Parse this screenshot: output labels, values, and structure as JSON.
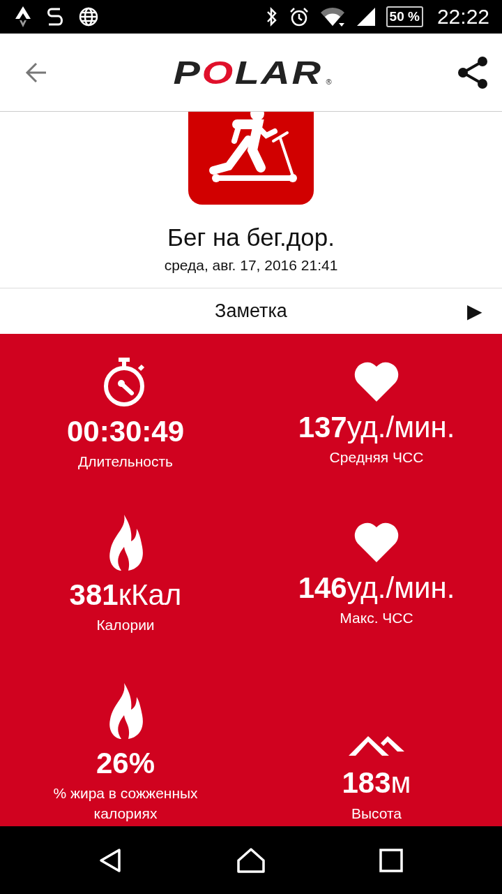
{
  "status_bar": {
    "battery": "50 %",
    "time": "22:22"
  },
  "header": {
    "logo": "POLAR",
    "registered_mark": "®"
  },
  "activity": {
    "title": "Бег на бег.дор.",
    "date": "среда, авг. 17, 2016 21:41"
  },
  "note": {
    "label": "Заметка",
    "arrow": "▶"
  },
  "stats": [
    {
      "kind": "stopwatch",
      "value": "**00:30:49**",
      "label": "Длительность"
    },
    {
      "kind": "heart",
      "value": "**137**уд./мин.",
      "label": "Средняя ЧСС"
    },
    {
      "kind": "flame",
      "value": "**381**кКал",
      "label": "Калории"
    },
    {
      "kind": "heart",
      "value": "**146**уд./мин.",
      "label": "Макс. ЧСС"
    },
    {
      "kind": "flame",
      "value": "**26%**",
      "label": "% жира в сожженных калориях"
    },
    {
      "kind": "mountain",
      "value": "**183**м",
      "label": "Высота"
    }
  ]
}
